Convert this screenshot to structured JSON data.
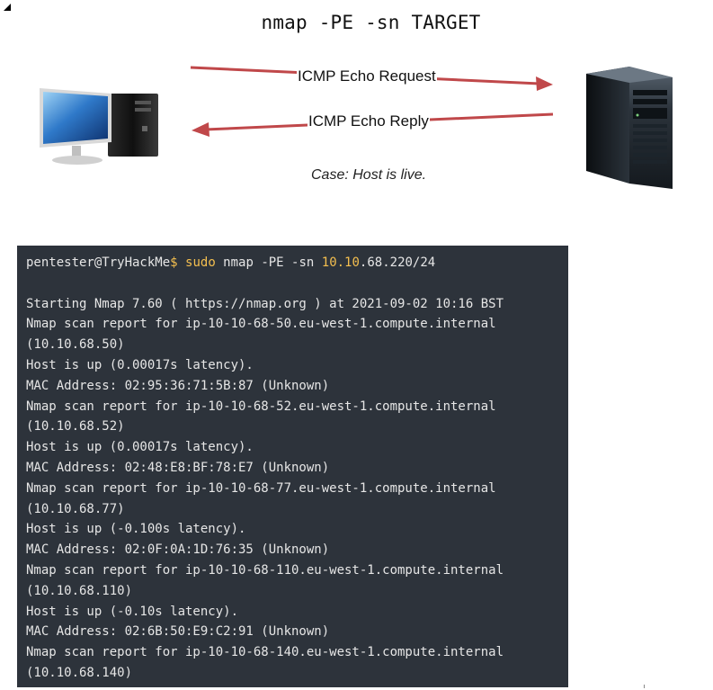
{
  "diagram": {
    "command": "nmap -PE -sn TARGET",
    "request_label": "ICMP Echo Request",
    "reply_label": "ICMP Echo Reply",
    "case_note": "Case: Host is live.",
    "arrow_color": "#c0484a",
    "client_icon": "desktop-computer-icon",
    "server_icon": "server-tower-icon"
  },
  "terminal": {
    "background": "#2d333b",
    "accent": "#f4bf4f",
    "prompt": {
      "user_host": "pentester@TryHackMe",
      "symbol": "$",
      "cmd_sudo": "sudo",
      "cmd_body": " nmap -PE -sn ",
      "target_highlight": "10.10",
      "target_rest": ".68.220/24"
    },
    "lines": [
      "",
      "Starting Nmap 7.60 ( https://nmap.org ) at 2021-09-02 10:16 BST",
      "Nmap scan report for ip-10-10-68-50.eu-west-1.compute.internal",
      "(10.10.68.50)",
      "Host is up (0.00017s latency).",
      "MAC Address: 02:95:36:71:5B:87 (Unknown)",
      "Nmap scan report for ip-10-10-68-52.eu-west-1.compute.internal",
      "(10.10.68.52)",
      "Host is up (0.00017s latency).",
      "MAC Address: 02:48:E8:BF:78:E7 (Unknown)",
      "Nmap scan report for ip-10-10-68-77.eu-west-1.compute.internal",
      "(10.10.68.77)",
      "Host is up (-0.100s latency).",
      "MAC Address: 02:0F:0A:1D:76:35 (Unknown)",
      "Nmap scan report for ip-10-10-68-110.eu-west-1.compute.internal",
      "(10.10.68.110)",
      "Host is up (-0.10s latency).",
      "MAC Address: 02:6B:50:E9:C2:91 (Unknown)",
      "Nmap scan report for ip-10-10-68-140.eu-west-1.compute.internal",
      "(10.10.68.140)"
    ]
  }
}
